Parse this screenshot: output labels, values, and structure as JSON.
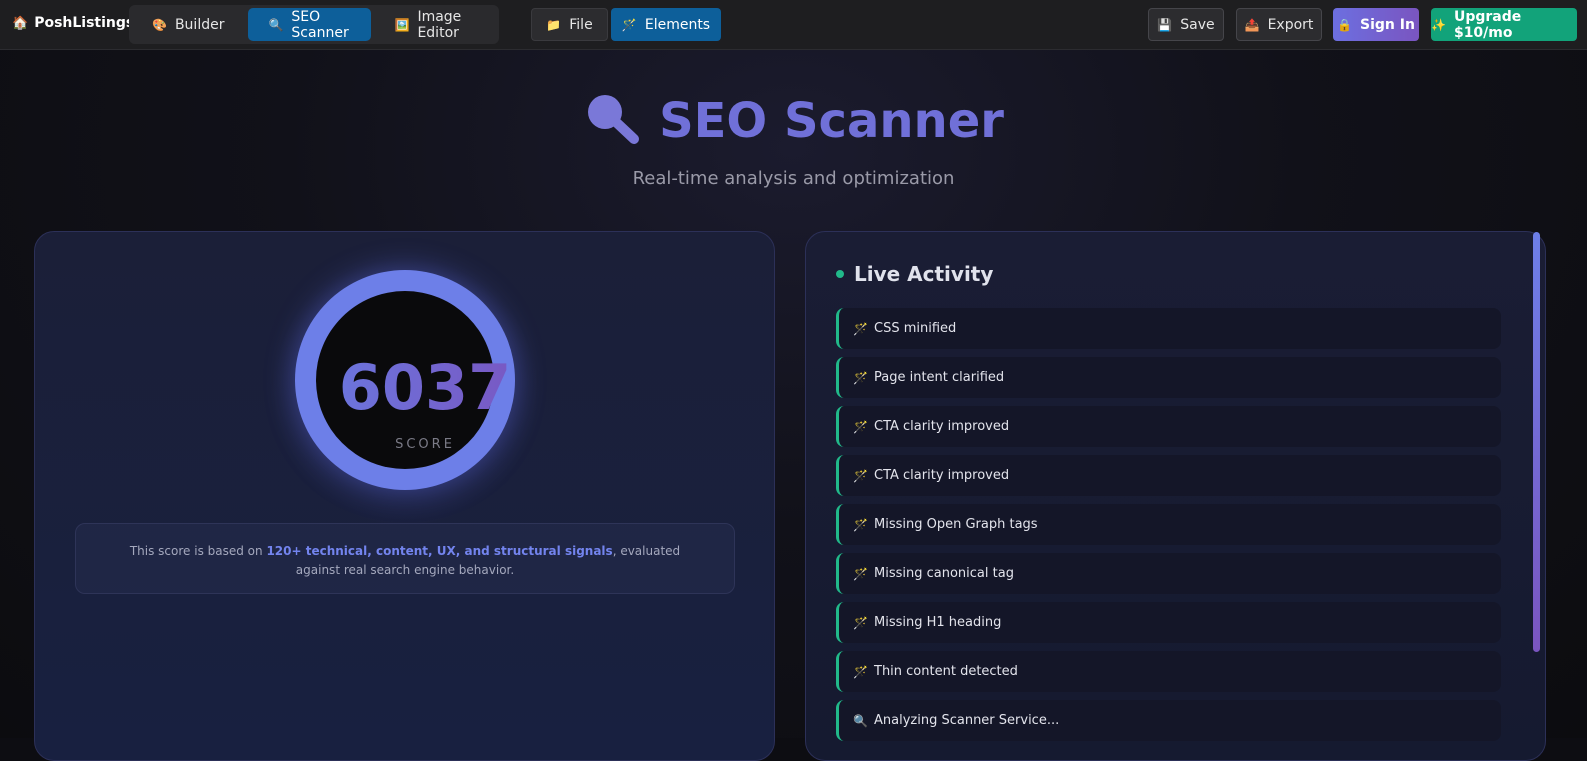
{
  "header": {
    "brand_icon": "🏠",
    "brand": "PoshListings",
    "tabs": [
      {
        "icon": "🎨",
        "label": "Builder",
        "active": false
      },
      {
        "icon": "🔍",
        "label": "SEO Scanner",
        "active": true
      },
      {
        "icon": "🖼️",
        "label": "Image Editor",
        "active": false
      }
    ],
    "file": {
      "icon": "📁",
      "label": "File"
    },
    "elements": {
      "icon": "🪄",
      "label": "Elements"
    },
    "save": {
      "icon": "💾",
      "label": "Save"
    },
    "export": {
      "icon": "📤",
      "label": "Export"
    },
    "signin": {
      "icon": "🔒",
      "label": "Sign In"
    },
    "upgrade": {
      "icon": "✨",
      "label": "Upgrade $10/mo"
    }
  },
  "hero": {
    "icon": "magnifier-icon",
    "title": "SEO Scanner",
    "subtitle": "Real-time analysis and optimization"
  },
  "score": {
    "value": "6037",
    "label": "SCORE",
    "note_prefix": "This score is based on ",
    "note_highlight": "120+ technical, content, UX, and structural signals",
    "note_suffix": ", evaluated against real search engine behavior."
  },
  "activity": {
    "title": "Live Activity",
    "items": [
      {
        "icon": "🪄",
        "text": "CSS minified"
      },
      {
        "icon": "🪄",
        "text": "Page intent clarified"
      },
      {
        "icon": "🪄",
        "text": "CTA clarity improved"
      },
      {
        "icon": "🪄",
        "text": "CTA clarity improved"
      },
      {
        "icon": "🪄",
        "text": "Missing Open Graph tags"
      },
      {
        "icon": "🪄",
        "text": "Missing canonical tag"
      },
      {
        "icon": "🪄",
        "text": "Missing H1 heading"
      },
      {
        "icon": "🪄",
        "text": "Thin content detected"
      },
      {
        "icon": "🔍",
        "text": "Analyzing Scanner Service..."
      }
    ]
  },
  "colors": {
    "accent": "#7070d8",
    "tab_active": "#0d5f9a",
    "upgrade": "#12a37a",
    "activity_border": "#21b98a"
  }
}
